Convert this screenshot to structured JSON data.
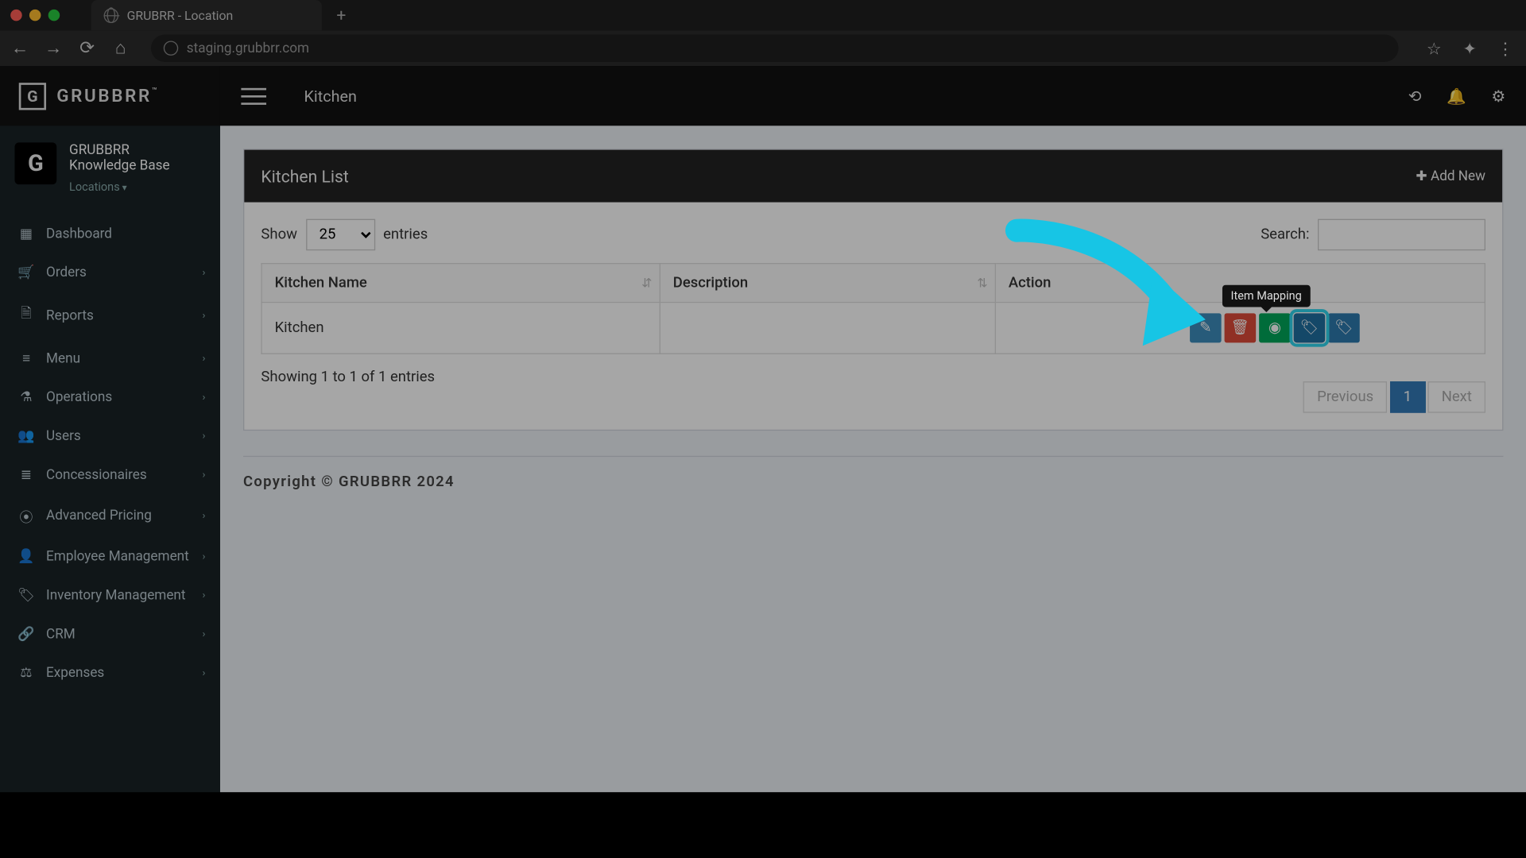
{
  "browser": {
    "tab_title": "GRUBRR - Location",
    "url": "staging.grubbrr.com"
  },
  "brand": {
    "name": "GRUBBRR",
    "tm": "™"
  },
  "user_panel": {
    "line1": "GRUBBRR",
    "line2": "Knowledge Base",
    "locations_label": "Locations"
  },
  "sidebar": {
    "items": [
      {
        "icon": "▦",
        "label": "Dashboard",
        "expandable": false
      },
      {
        "icon": "🛒",
        "label": "Orders",
        "expandable": true
      },
      {
        "icon": "🗎",
        "label": "Reports",
        "expandable": true
      },
      {
        "icon": "≡",
        "label": "Menu",
        "expandable": true
      },
      {
        "icon": "⚗",
        "label": "Operations",
        "expandable": true
      },
      {
        "icon": "👥",
        "label": "Users",
        "expandable": true
      },
      {
        "icon": "≣",
        "label": "Concessionaires",
        "expandable": true
      },
      {
        "icon": "⦿",
        "label": "Advanced Pricing",
        "expandable": true
      },
      {
        "icon": "👤",
        "label": "Employee Management",
        "expandable": true
      },
      {
        "icon": "🏷",
        "label": "Inventory Management",
        "expandable": true
      },
      {
        "icon": "🔗",
        "label": "CRM",
        "expandable": true
      },
      {
        "icon": "⚖",
        "label": "Expenses",
        "expandable": true
      }
    ]
  },
  "topbar": {
    "title": "Kitchen"
  },
  "panel": {
    "title": "Kitchen List",
    "add_new_label": "Add New"
  },
  "datatable": {
    "show_label": "Show",
    "entries_label": "entries",
    "page_size": "25",
    "search_label": "Search:",
    "columns": {
      "name": "Kitchen Name",
      "description": "Description",
      "action": "Action"
    },
    "rows": [
      {
        "name": "Kitchen",
        "description": ""
      }
    ],
    "info": "Showing 1 to 1 of 1 entries",
    "paginate": {
      "prev": "Previous",
      "next": "Next",
      "page": "1"
    }
  },
  "tooltip": {
    "item_mapping": "Item Mapping"
  },
  "footer": {
    "copyright": "Copyright © GRUBBRR 2024"
  },
  "colors": {
    "highlight": "#2fd6ef",
    "primary": "#337ab7"
  }
}
